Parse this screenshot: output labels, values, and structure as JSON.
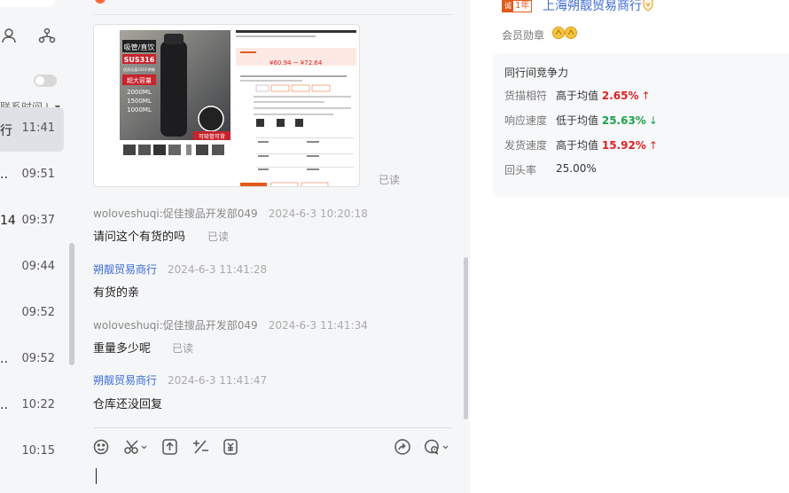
{
  "conversation_list": {
    "sort_label": "联系时间⇃ ▾",
    "items": [
      {
        "left": "行",
        "time": "11:41",
        "active": true
      },
      {
        "left": "..",
        "time": "09:51",
        "active": false
      },
      {
        "left": "14",
        "time": "09:37",
        "active": false
      },
      {
        "left": "",
        "time": "09:44",
        "active": false
      },
      {
        "left": "",
        "time": "09:52",
        "active": false
      },
      {
        "left": "..",
        "time": "09:52",
        "active": false
      },
      {
        "left": "..",
        "time": "10:22",
        "active": false
      },
      {
        "left": "",
        "time": "10:15",
        "active": false
      }
    ]
  },
  "chat": {
    "image_read": "已读",
    "messages": [
      {
        "sender": "woloveshuqi:促佳搜品开发部049",
        "time": "2024-6-3 10:20:18",
        "text": "请问这个有货的吗",
        "read": "已读",
        "role": "buyer"
      },
      {
        "sender": "朔靓贸易商行",
        "time": "2024-6-3 11:41:28",
        "text": "有货的亲",
        "read": "",
        "role": "seller"
      },
      {
        "sender": "woloveshuqi:促佳搜品开发部049",
        "time": "2024-6-3 11:41:34",
        "text": "重量多少呢",
        "read": "已读",
        "role": "buyer"
      },
      {
        "sender": "朔靓贸易商行",
        "time": "2024-6-3 11:41:47",
        "text": "仓库还没回复",
        "read": "",
        "role": "seller"
      }
    ],
    "product_image": {
      "text_1": "吸管/直饮",
      "text_2": "SUS316",
      "text_3": "优质无菌316不锈钢",
      "text_4": "超大容量",
      "text_5": "2000ML",
      "text_6": "1500ML",
      "text_7": "1000ML",
      "text_8": "可吸管可背",
      "price": "¥60.94 ~ ¥72.64"
    }
  },
  "shop": {
    "year_badge": "1年",
    "year_badge_icon": "诚",
    "name": "上海朔靓贸易商行",
    "medal_label": "会员勋章",
    "compete_title": "同行间竞争力",
    "metrics": [
      {
        "label": "货描相符",
        "compare": "高于均值",
        "value": "2.65%",
        "arrow": "↑",
        "trend": "up"
      },
      {
        "label": "响应速度",
        "compare": "低于均值",
        "value": "25.63%",
        "arrow": "↓",
        "trend": "down"
      },
      {
        "label": "发货速度",
        "compare": "高于均值",
        "value": "15.92%",
        "arrow": "↑",
        "trend": "up"
      },
      {
        "label": "回头率",
        "compare": "",
        "value": "25.00%",
        "arrow": "",
        "trend": "plain"
      }
    ]
  },
  "colors": {
    "accent_blue": "#3a6bd6",
    "up_red": "#e02020",
    "down_green": "#1aa34a",
    "badge_orange": "#e25a1c"
  }
}
